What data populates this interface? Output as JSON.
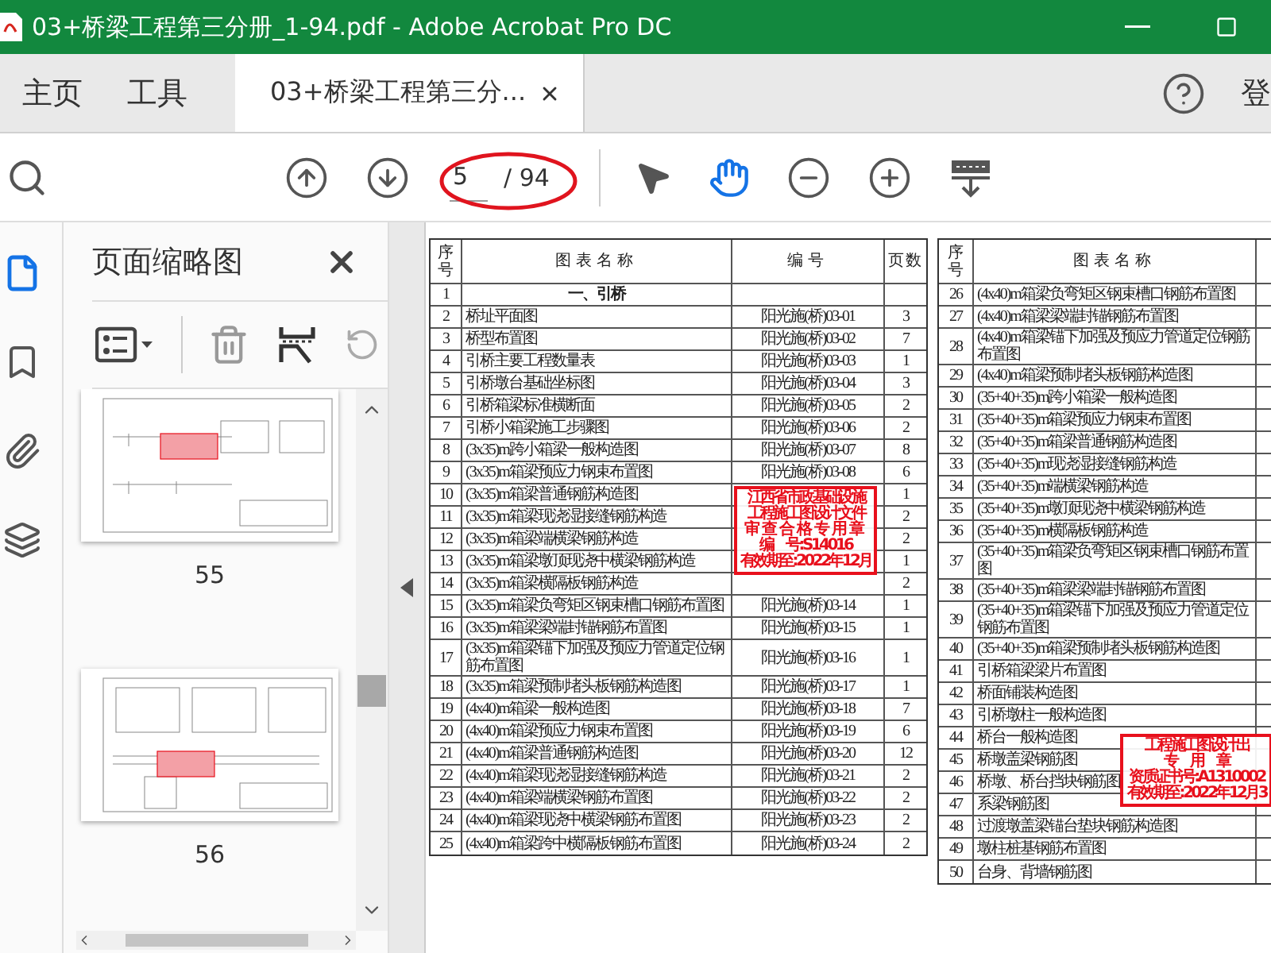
{
  "window": {
    "title": "03+桥梁工程第三分册_1-94.pdf - Adobe Acrobat Pro DC"
  },
  "tabs": [
    {
      "label": "主页",
      "kind": "nav",
      "selected": false
    },
    {
      "label": "工具",
      "kind": "nav",
      "selected": false
    },
    {
      "label": "03+桥梁工程第三分...",
      "kind": "document",
      "selected": true
    }
  ],
  "account_label": "登",
  "toolbar": {
    "page_current": "5",
    "page_total": "/ 94",
    "tools": [
      {
        "kind": "select",
        "selected": false
      },
      {
        "kind": "hand",
        "selected": true
      }
    ]
  },
  "sidebar": {
    "rail": [
      {
        "kind": "pages",
        "selected": true
      },
      {
        "kind": "bookmarks",
        "selected": false
      },
      {
        "kind": "attachments",
        "selected": false
      },
      {
        "kind": "layers",
        "selected": false
      }
    ],
    "title": "页面缩略图",
    "thumbnails": [
      {
        "label": "55"
      },
      {
        "label": "56"
      }
    ]
  },
  "document": {
    "columns": [
      "序号",
      "图表名称",
      "编号",
      "页数"
    ],
    "left_rows": [
      {
        "no": "1",
        "name": "一、引桥",
        "kind": "section"
      },
      {
        "no": "2",
        "name": "桥址平面图",
        "code": "阳光施(桥)03-01",
        "pages": "3",
        "kind": "item"
      },
      {
        "no": "3",
        "name": "桥型布置图",
        "code": "阳光施(桥)03-02",
        "pages": "7",
        "kind": "item"
      },
      {
        "no": "4",
        "name": "引桥主要工程数量表",
        "code": "阳光施(桥)03-03",
        "pages": "1",
        "kind": "item"
      },
      {
        "no": "5",
        "name": "引桥墩台基础坐标图",
        "code": "阳光施(桥)03-04",
        "pages": "3",
        "kind": "item"
      },
      {
        "no": "6",
        "name": "引桥箱梁标准横断面",
        "code": "阳光施(桥)03-05",
        "pages": "2",
        "kind": "item"
      },
      {
        "no": "7",
        "name": "引桥小箱梁施工步骤图",
        "code": "阳光施(桥)03-06",
        "pages": "2",
        "kind": "item"
      },
      {
        "no": "8",
        "name": "(3x35)m跨小箱梁一般构造图",
        "code": "阳光施(桥)03-07",
        "pages": "8",
        "kind": "item"
      },
      {
        "no": "9",
        "name": "(3x35)m箱梁预应力钢束布置图",
        "code": "阳光施(桥)03-08",
        "pages": "6",
        "kind": "item"
      },
      {
        "no": "10",
        "name": "(3x35)m箱梁普通钢筋构造图",
        "pages": "1",
        "kind": "item",
        "stamp": {
          "lines": [
            "江西省市政基础设施",
            "工程施工图设计文件",
            "审查合格专用章",
            "编　号:S14016",
            "有效期至:2022年12月"
          ]
        }
      },
      {
        "no": "11",
        "name": "(3x35)m箱梁现浇湿接缝钢筋构造",
        "pages": "2",
        "kind": "item"
      },
      {
        "no": "12",
        "name": "(3x35)m箱梁端横梁钢筋构造",
        "pages": "2",
        "kind": "item"
      },
      {
        "no": "13",
        "name": "(3x35)m箱梁墩顶现浇中横梁钢筋构造",
        "pages": "1",
        "kind": "item"
      },
      {
        "no": "14",
        "name": "(3x35)m箱梁横隔板钢筋构造",
        "pages": "2",
        "kind": "item"
      },
      {
        "no": "15",
        "name": "(3x35)m箱梁负弯矩区钢束槽口钢筋布置图",
        "code": "阳光施(桥)03-14",
        "pages": "1",
        "kind": "item"
      },
      {
        "no": "16",
        "name": "(3x35)m箱梁梁端封锚钢筋布置图",
        "code": "阳光施(桥)03-15",
        "pages": "1",
        "kind": "item"
      },
      {
        "no": "17",
        "name": "(3x35)m箱梁锚下加强及预应力管道定位钢筋布置图",
        "code": "阳光施(桥)03-16",
        "pages": "1",
        "kind": "item"
      },
      {
        "no": "18",
        "name": "(3x35)m箱梁预制堵头板钢筋构造图",
        "code": "阳光施(桥)03-17",
        "pages": "1",
        "kind": "item"
      },
      {
        "no": "19",
        "name": "(4x40)m箱梁一般构造图",
        "code": "阳光施(桥)03-18",
        "pages": "7",
        "kind": "item"
      },
      {
        "no": "20",
        "name": "(4x40)m箱梁预应力钢束布置图",
        "code": "阳光施(桥)03-19",
        "pages": "6",
        "kind": "item"
      },
      {
        "no": "21",
        "name": "(4x40)m箱梁普通钢筋构造图",
        "code": "阳光施(桥)03-20",
        "pages": "12",
        "kind": "item"
      },
      {
        "no": "22",
        "name": "(4x40)m箱梁现浇湿接缝钢筋构造",
        "code": "阳光施(桥)03-21",
        "pages": "2",
        "kind": "item"
      },
      {
        "no": "23",
        "name": "(4x40)m箱梁端横梁钢筋布置图",
        "code": "阳光施(桥)03-22",
        "pages": "2",
        "kind": "item"
      },
      {
        "no": "24",
        "name": "(4x40)m箱梁现浇中横梁钢筋布置图",
        "code": "阳光施(桥)03-23",
        "pages": "2",
        "kind": "item"
      },
      {
        "no": "25",
        "name": "(4x40)m箱梁跨中横隔板钢筋布置图",
        "code": "阳光施(桥)03-24",
        "pages": "2",
        "kind": "item"
      }
    ],
    "right_columns": [
      "序号",
      "图表名称"
    ],
    "right_rows": [
      {
        "no": "26",
        "name": "(4x40)m箱梁负弯矩区钢束槽口钢筋布置图"
      },
      {
        "no": "27",
        "name": "(4x40)m箱梁梁端封锚钢筋布置图"
      },
      {
        "no": "28",
        "name": "(4x40)m箱梁锚下加强及预应力管道定位钢筋布置图"
      },
      {
        "no": "29",
        "name": "(4x40)m箱梁预制堵头板钢筋构造图"
      },
      {
        "no": "30",
        "name": "(35+40+35)m跨小箱梁一般构造图"
      },
      {
        "no": "31",
        "name": "(35+40+35)m箱梁预应力钢束布置图"
      },
      {
        "no": "32",
        "name": "(35+40+35)m箱梁普通钢筋构造图"
      },
      {
        "no": "33",
        "name": "(35+40+35)m现浇湿接缝钢筋构造"
      },
      {
        "no": "34",
        "name": "(35+40+35)m端横梁钢筋构造"
      },
      {
        "no": "35",
        "name": "(35+40+35)m墩顶现浇中横梁钢筋构造"
      },
      {
        "no": "36",
        "name": "(35+40+35)m横隔板钢筋构造"
      },
      {
        "no": "37",
        "name": "(35+40+35)m箱梁负弯矩区钢束槽口钢筋布置图"
      },
      {
        "no": "38",
        "name": "(35+40+35)m箱梁梁端封锚钢筋布置图"
      },
      {
        "no": "39",
        "name": "(35+40+35)m箱梁锚下加强及预应力管道定位钢筋布置图"
      },
      {
        "no": "40",
        "name": "(35+40+35)m箱梁预制堵头板钢筋构造图"
      },
      {
        "no": "41",
        "name": "引桥箱梁梁片布置图"
      },
      {
        "no": "42",
        "name": "桥面铺装构造图"
      },
      {
        "no": "43",
        "name": "引桥墩柱一般构造图"
      },
      {
        "no": "44",
        "name": "桥台一般构造图"
      },
      {
        "no": "45",
        "name": "桥墩盖梁钢筋图",
        "stamp": {
          "lines": [
            "工程施工图设计出",
            "专　用　章",
            "资质证书号:A1310002",
            "有效期至:2022年12月3"
          ]
        }
      },
      {
        "no": "46",
        "name": "桥墩、桥台挡块钢筋图"
      },
      {
        "no": "47",
        "name": "系梁钢筋图"
      },
      {
        "no": "48",
        "name": "过渡墩盖梁锚台垫块钢筋构造图"
      },
      {
        "no": "49",
        "name": "墩柱桩基钢筋布置图"
      },
      {
        "no": "50",
        "name": "台身、背墙钢筋图"
      }
    ]
  }
}
